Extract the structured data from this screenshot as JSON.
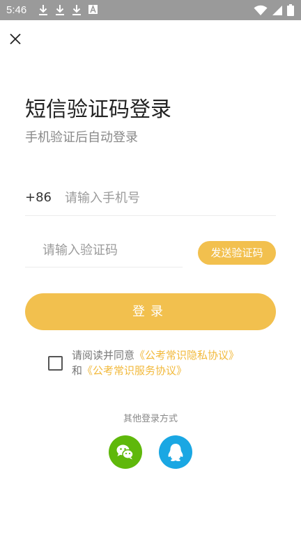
{
  "status_bar": {
    "time": "5:46",
    "left_icons": [
      "download-icon",
      "download-icon",
      "download-icon",
      "a-icon"
    ],
    "right_icons": [
      "wifi-icon",
      "signal-icon",
      "battery-icon"
    ]
  },
  "header": {
    "close_icon": "close-icon"
  },
  "title": "短信验证码登录",
  "subtitle": "手机验证后自动登录",
  "phone": {
    "country_code": "+86",
    "placeholder": "请输入手机号",
    "value": ""
  },
  "code": {
    "placeholder": "请输入验证码",
    "value": "",
    "send_label": "发送验证码"
  },
  "login_label": "登录",
  "agreement": {
    "checked": false,
    "prefix": "请阅读并同意",
    "privacy_link": "《公考常识隐私协议》",
    "and_text": "和",
    "service_link": "《公考常识服务协议》"
  },
  "other_login": {
    "label": "其他登录方式",
    "options": [
      {
        "icon": "wechat-icon",
        "color": "#5fb80b"
      },
      {
        "icon": "qq-icon",
        "color": "#1aa7e3"
      }
    ]
  },
  "colors": {
    "accent": "#f2c04e",
    "link": "#f2b93b",
    "status_bar": "#9a9a9a"
  }
}
